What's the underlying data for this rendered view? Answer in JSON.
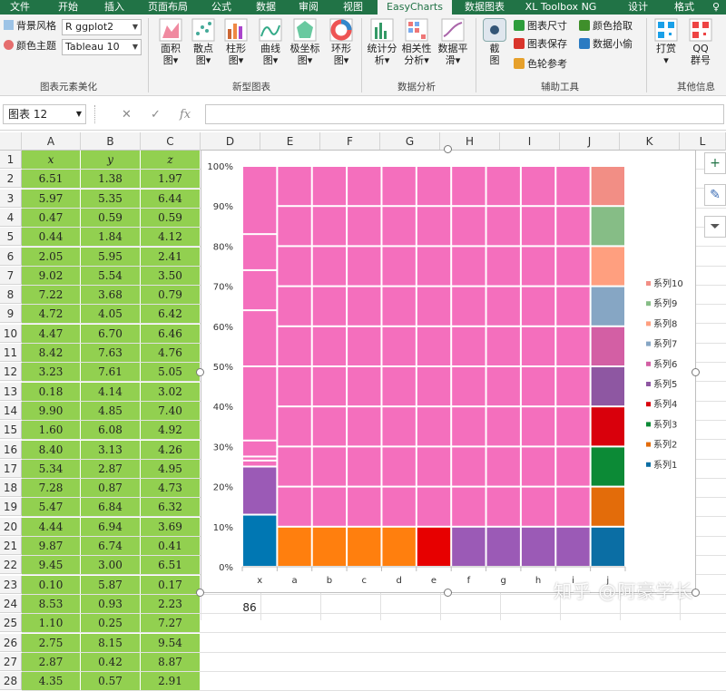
{
  "tabs": [
    "文件",
    "开始",
    "插入",
    "页面布局",
    "公式",
    "数据",
    "审阅",
    "视图",
    "EasyCharts",
    "数据图表",
    "XL Toolbox NG",
    "设计",
    "格式",
    "♀"
  ],
  "active_tab": "EasyCharts",
  "ribbon": {
    "group1": {
      "bg_style_label": "背景风格",
      "color_theme_label": "颜色主题",
      "bg_style_value": "R ggplot2",
      "color_theme_value": "Tableau 10",
      "name": "图表元素美化"
    },
    "group2": {
      "buttons": [
        {
          "label": "面积\n图▾",
          "icon": "area-chart-icon"
        },
        {
          "label": "散点\n图▾",
          "icon": "scatter-chart-icon"
        },
        {
          "label": "柱形\n图▾",
          "icon": "column-chart-icon"
        },
        {
          "label": "曲线\n图▾",
          "icon": "curve-chart-icon"
        },
        {
          "label": "极坐标\n图▾",
          "icon": "polar-chart-icon"
        },
        {
          "label": "环形\n图▾",
          "icon": "ring-chart-icon"
        }
      ],
      "name": "新型图表"
    },
    "group3": {
      "buttons": [
        {
          "label": "统计分\n析▾",
          "icon": "statistics-icon"
        },
        {
          "label": "相关性\n分析▾",
          "icon": "correlation-icon"
        },
        {
          "label": "数据平\n滑▾",
          "icon": "smoothing-icon"
        }
      ],
      "name": "数据分析"
    },
    "group4": {
      "screenshot": "截\n图",
      "minis": [
        {
          "label": "图表尺寸",
          "color": "#2e9d3c"
        },
        {
          "label": "颜色拾取",
          "color": "#3f8f2b"
        },
        {
          "label": "图表保存",
          "color": "#d9342b"
        },
        {
          "label": "数据小偷",
          "color": "#2b7bc2"
        },
        {
          "label": "色轮参考",
          "color": "#e6a02b"
        }
      ],
      "name": "辅助工具"
    },
    "group5": {
      "buttons": [
        {
          "label": "打赏\n▾",
          "icon": "reward-icon"
        },
        {
          "label": "QQ\n群号",
          "icon": "qq-group-icon"
        }
      ],
      "name": "其他信息"
    }
  },
  "formula_bar": {
    "name_box": "图表 12",
    "cancel": "✕",
    "confirm": "✓",
    "fx": "fx",
    "formula": ""
  },
  "columns": [
    "A",
    "B",
    "C",
    "D",
    "E",
    "F",
    "G",
    "H",
    "I",
    "J",
    "K",
    "L"
  ],
  "table": {
    "headers": [
      "x",
      "y",
      "z"
    ],
    "rows": [
      [
        "6.51",
        "1.38",
        "1.97"
      ],
      [
        "5.97",
        "5.35",
        "6.44"
      ],
      [
        "0.47",
        "0.59",
        "0.59"
      ],
      [
        "0.44",
        "1.84",
        "4.12"
      ],
      [
        "2.05",
        "5.95",
        "2.41"
      ],
      [
        "9.02",
        "5.54",
        "3.50"
      ],
      [
        "7.22",
        "3.68",
        "0.79"
      ],
      [
        "4.72",
        "4.05",
        "6.42"
      ],
      [
        "4.47",
        "6.70",
        "6.46"
      ],
      [
        "8.42",
        "7.63",
        "4.76"
      ],
      [
        "3.23",
        "7.61",
        "5.05"
      ],
      [
        "0.18",
        "4.14",
        "3.02"
      ],
      [
        "9.90",
        "4.85",
        "7.40"
      ],
      [
        "1.60",
        "6.08",
        "4.92"
      ],
      [
        "8.40",
        "3.13",
        "4.26"
      ],
      [
        "5.34",
        "2.87",
        "4.95"
      ],
      [
        "7.28",
        "0.87",
        "4.73"
      ],
      [
        "5.47",
        "6.84",
        "6.32"
      ],
      [
        "4.44",
        "6.94",
        "3.69"
      ],
      [
        "9.87",
        "6.74",
        "0.41"
      ],
      [
        "9.45",
        "3.00",
        "6.51"
      ],
      [
        "0.10",
        "5.87",
        "0.17"
      ],
      [
        "8.53",
        "0.93",
        "2.23"
      ],
      [
        "1.10",
        "0.25",
        "7.27"
      ],
      [
        "2.75",
        "8.15",
        "9.54"
      ],
      [
        "2.87",
        "0.42",
        "8.87"
      ],
      [
        "4.35",
        "0.57",
        "2.91"
      ]
    ]
  },
  "cell_d28": "86",
  "chart_data": {
    "type": "bar",
    "stacked": "100%",
    "categories": [
      "x",
      "a",
      "b",
      "c",
      "d",
      "e",
      "f",
      "g",
      "h",
      "i",
      "j"
    ],
    "y_tick_labels": [
      "0%",
      "10%",
      "20%",
      "30%",
      "40%",
      "50%",
      "60%",
      "70%",
      "80%",
      "90%",
      "100%"
    ],
    "ylim": [
      0,
      100
    ],
    "legend_position": "right",
    "legend": [
      {
        "name": "系列10",
        "color": "#f28e85"
      },
      {
        "name": "系列9",
        "color": "#86bd86"
      },
      {
        "name": "系列8",
        "color": "#ff9f7f"
      },
      {
        "name": "系列7",
        "color": "#86a6c4"
      },
      {
        "name": "系列6",
        "color": "#d35fa4"
      },
      {
        "name": "系列5",
        "color": "#8e57a2"
      },
      {
        "name": "系列4",
        "color": "#d9000c"
      },
      {
        "name": "系列3",
        "color": "#0c8a36"
      },
      {
        "name": "系列2",
        "color": "#e36c0a"
      },
      {
        "name": "系列1",
        "color": "#0b6ea4"
      }
    ],
    "fill_colors": {
      "main": "#f46fbd",
      "orange": "#ff7f0e",
      "red": "#e70000",
      "purple": "#9b5ab6",
      "blue": "#0077b3"
    },
    "x_segments": [
      {
        "from": 0,
        "to": 13,
        "color": "#0077b3"
      },
      {
        "from": 13,
        "to": 25,
        "color": "#9b5ab6"
      },
      {
        "from": 25,
        "to": 26.5,
        "color": "#f46fbd"
      },
      {
        "from": 26.5,
        "to": 27.5,
        "color": "#f46fbd"
      },
      {
        "from": 27.5,
        "to": 31.5,
        "color": "#f46fbd"
      },
      {
        "from": 31.5,
        "to": 50,
        "color": "#f46fbd"
      },
      {
        "from": 50,
        "to": 64,
        "color": "#f46fbd"
      },
      {
        "from": 64,
        "to": 74,
        "color": "#f46fbd"
      },
      {
        "from": 74,
        "to": 83,
        "color": "#f46fbd"
      },
      {
        "from": 83,
        "to": 100,
        "color": "#f46fbd"
      }
    ],
    "bottom_colors": [
      "#ff7f0e",
      "#ff7f0e",
      "#ff7f0e",
      "#ff7f0e",
      "#e70000",
      "#9b5ab6",
      "#9b5ab6",
      "#9b5ab6",
      "#9b5ab6"
    ],
    "j_segments": [
      {
        "from": 0,
        "to": 10,
        "color": "#0b6ea4"
      },
      {
        "from": 10,
        "to": 20,
        "color": "#e36c0a"
      },
      {
        "from": 20,
        "to": 30,
        "color": "#0c8a36"
      },
      {
        "from": 30,
        "to": 40,
        "color": "#d9000c"
      },
      {
        "from": 40,
        "to": 50,
        "color": "#8e57a2"
      },
      {
        "from": 50,
        "to": 60,
        "color": "#d35fa4"
      },
      {
        "from": 60,
        "to": 70,
        "color": "#86a6c4"
      },
      {
        "from": 70,
        "to": 80,
        "color": "#ff9f7f"
      },
      {
        "from": 80,
        "to": 90,
        "color": "#86bd86"
      },
      {
        "from": 90,
        "to": 100,
        "color": "#f28e85"
      }
    ]
  },
  "watermark": "知乎 @阿豪学长",
  "side_buttons": [
    {
      "glyph": "+",
      "icon": "add-element-icon"
    },
    {
      "glyph": "✎",
      "icon": "brush-style-icon"
    },
    {
      "glyph": "⏷",
      "icon": "filter-icon"
    }
  ]
}
